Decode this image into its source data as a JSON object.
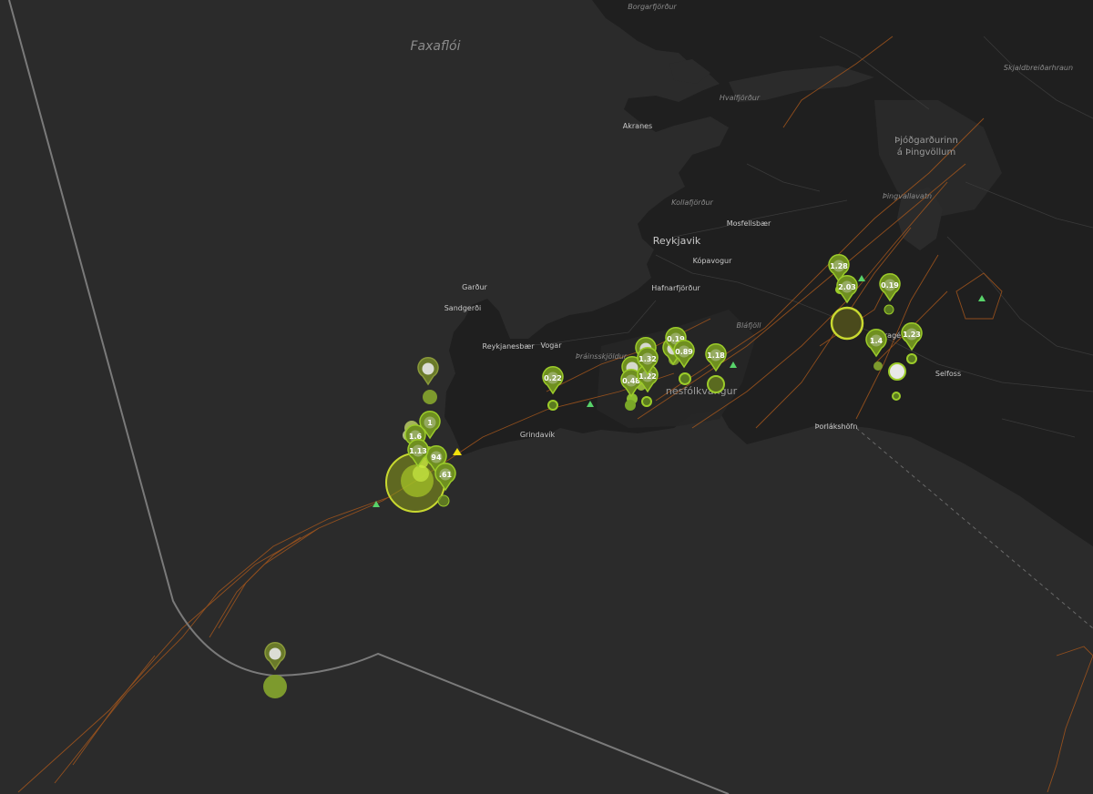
{
  "map": {
    "water_labels": [
      {
        "text": "Faxaflói"
      }
    ],
    "places": {
      "reykjavik": "Reykjavik",
      "kopavogur": "Kópavogur",
      "hafnarfjordur": "Hafnarfjörður",
      "mosfellsbaer": "Mosfellsbær",
      "akranes": "Akranes",
      "gardur": "Garður",
      "sandgerdi": "Sandgerði",
      "reykjanesbaer": "Reykjanesbær",
      "vogar": "Vogar",
      "grindavik": "Grindavík",
      "thorlakshofn": "Þorlákshöfn",
      "selfoss": "Selfoss",
      "hveragerdi": "ragé"
    },
    "minor_places": {
      "borgarfjordur": "Borgarfjörður",
      "hvalfjordur": "Hvalfjörður",
      "kollafjordur": "Kollafjörður",
      "thingvallavatn": "Þingvallavatn",
      "skjaldbreidarhraun": "Skjaldbreiðarhraun",
      "thraninsskjoldur": "Þráinsskjöldur",
      "blafjoll": "Bláfjöll"
    },
    "parks": {
      "thingvellir_line1": "Þjóðgarðurinn",
      "thingvellir_line2": "á Þingvöllum",
      "reykjanesfolkvangur": "nesfólkvangur"
    }
  },
  "colors": {
    "background": "#2b2b2b",
    "land": "#1f1f1f",
    "fault": "#a4561c",
    "boundary": "#7a7a7a",
    "quake_green": "#9ccc2a",
    "quake_olive": "#7d9a2d",
    "quake_yellow": "#c8d830",
    "station_green": "#58d36a",
    "station_yellow": "#f2e20c"
  },
  "pins": [
    {
      "id": "p1",
      "label": "0.22"
    },
    {
      "id": "p2",
      "label": "0.19"
    },
    {
      "id": "p3",
      "label": "0.89"
    },
    {
      "id": "p4",
      "label": "1.18"
    },
    {
      "id": "p5",
      "label": "0.48"
    },
    {
      "id": "p6",
      "label": "1.22"
    },
    {
      "id": "p7",
      "label": "1.32"
    },
    {
      "id": "p8",
      "label": "1.28"
    },
    {
      "id": "p9",
      "label": "2.03"
    },
    {
      "id": "p10",
      "label": "0.19"
    },
    {
      "id": "p11",
      "label": "1.23"
    },
    {
      "id": "p12",
      "label": "1"
    },
    {
      "id": "p13",
      "label": "1.6"
    },
    {
      "id": "p14",
      "label": "94"
    },
    {
      "id": "p15",
      "label": ".61"
    },
    {
      "id": "p16",
      "label": "1.13"
    },
    {
      "id": "p17",
      "label": "1.4"
    }
  ]
}
